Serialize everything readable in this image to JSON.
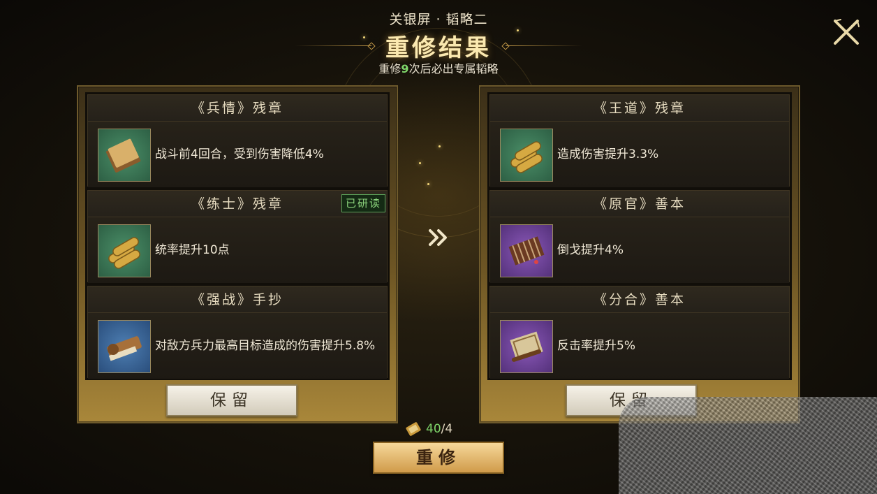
{
  "header": {
    "subtitle": "关银屏 · 韬略二",
    "title": "重修结果",
    "hint_prefix": "重修",
    "hint_count": "9",
    "hint_suffix": "次后必出专属韬略"
  },
  "left_panel": {
    "slots": [
      {
        "name": "《兵情》残章",
        "desc": "战斗前4回合，受到伤害降低4%",
        "icon": "book-icon",
        "rarity_color": "#3f7a5a"
      },
      {
        "name": "《练士》残章",
        "desc": "统率提升10点",
        "icon": "scroll-bundle-icon",
        "rarity_color": "#3f7a5a",
        "badge": "已研读"
      },
      {
        "name": "《强战》手抄",
        "desc": "对敌方兵力最高目标造成的伤害提升5.8%",
        "icon": "bamboo-scroll-icon",
        "rarity_color": "#3c6aa0"
      }
    ],
    "keep_label": "保留"
  },
  "right_panel": {
    "slots": [
      {
        "name": "《王道》残章",
        "desc": "造成伤害提升3.3%",
        "icon": "scroll-bundle-icon",
        "rarity_color": "#3f7a5a"
      },
      {
        "name": "《原官》善本",
        "desc": "倒戈提升4%",
        "icon": "bamboo-book-icon",
        "rarity_color": "#7a4aa8"
      },
      {
        "name": "《分合》善本",
        "desc": "反击率提升5%",
        "icon": "open-scroll-icon",
        "rarity_color": "#7a4aa8"
      }
    ],
    "keep_label": "保留"
  },
  "cost": {
    "have": "40",
    "need": "/4",
    "icon": "scroll-token-icon"
  },
  "reforge_label": "重修",
  "colors": {
    "accent_gold": "#c9a24f",
    "highlight_green": "#7fd66a",
    "panel_border": "#6e5a2c"
  }
}
